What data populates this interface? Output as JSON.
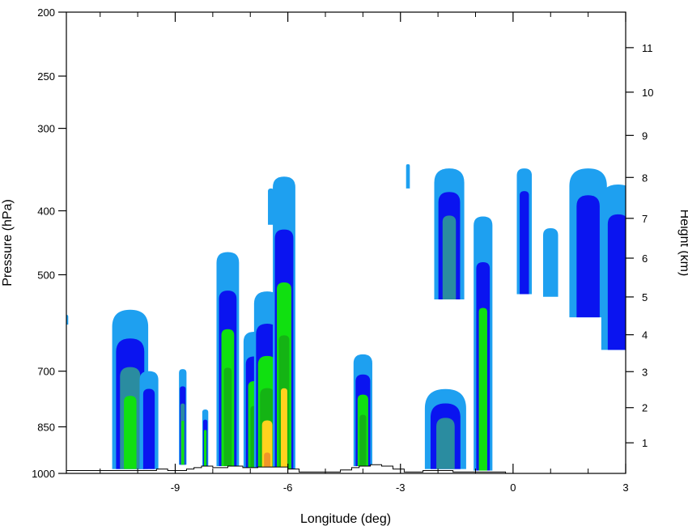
{
  "chart_data": {
    "type": "contour",
    "xlabel": "Longitude (deg)",
    "ylabel": "Pressure (hPa)",
    "y2label": "Height (km)",
    "xlim": [
      -11.9,
      3
    ],
    "ylim": [
      1000,
      200
    ],
    "yscale": "log",
    "x_ticks": [
      -9,
      -6,
      -3,
      0,
      3
    ],
    "x_tick_labels": [
      "-9",
      "-6",
      "-3",
      "0",
      "3"
    ],
    "y_ticks": [
      200,
      250,
      300,
      400,
      500,
      700,
      850,
      1000
    ],
    "y_tick_labels": [
      "200",
      "250",
      "300",
      "400",
      "500",
      "700",
      "850",
      "1000"
    ],
    "y2_ticks": [
      1,
      2,
      3,
      4,
      5,
      6,
      7,
      8,
      9,
      10,
      11
    ],
    "y2_tick_labels": [
      "1",
      "2",
      "3",
      "4",
      "5",
      "6",
      "7",
      "8",
      "9",
      "10",
      "11"
    ],
    "levels": [
      {
        "level": 1,
        "color": "#1ea0f0"
      },
      {
        "level": 2,
        "color": "#0a14f0"
      },
      {
        "level": 3,
        "color": "#2a8ca0"
      },
      {
        "level": 4,
        "color": "#10e010"
      },
      {
        "level": 5,
        "color": "#14b414"
      },
      {
        "level": 6,
        "color": "#ffd21e"
      },
      {
        "level": 7,
        "color": "#f09628"
      }
    ],
    "cells": [
      {
        "x": -10.2,
        "ptop": 565,
        "pbot": 985,
        "hw": 0.48,
        "levels": [
          1,
          2,
          3,
          4
        ]
      },
      {
        "x": -9.7,
        "ptop": 700,
        "pbot": 985,
        "hw": 0.25,
        "levels": [
          1,
          2
        ]
      },
      {
        "x": -8.8,
        "ptop": 695,
        "pbot": 970,
        "hw": 0.1,
        "levels": [
          1,
          2,
          3,
          4
        ]
      },
      {
        "x": -8.2,
        "ptop": 800,
        "pbot": 975,
        "hw": 0.08,
        "levels": [
          1,
          2,
          4
        ]
      },
      {
        "x": -7.6,
        "ptop": 462,
        "pbot": 975,
        "hw": 0.3,
        "levels": [
          1,
          2,
          4,
          5
        ]
      },
      {
        "x": -6.9,
        "ptop": 610,
        "pbot": 985,
        "hw": 0.28,
        "levels": [
          1,
          2,
          4,
          5
        ]
      },
      {
        "x": -6.55,
        "ptop": 530,
        "pbot": 990,
        "hw": 0.35,
        "levels": [
          1,
          2,
          4,
          5,
          6,
          7
        ]
      },
      {
        "x": -6.1,
        "ptop": 355,
        "pbot": 990,
        "hw": 0.3,
        "levels": [
          1,
          2,
          4,
          5,
          6
        ]
      },
      {
        "x": -6.45,
        "ptop": 370,
        "pbot": 420,
        "hw": 0.08,
        "levels": [
          1
        ]
      },
      {
        "x": -4.0,
        "ptop": 660,
        "pbot": 975,
        "hw": 0.25,
        "levels": [
          1,
          2,
          4,
          5
        ]
      },
      {
        "x": -2.8,
        "ptop": 340,
        "pbot": 370,
        "hw": 0.05,
        "levels": [
          1
        ]
      },
      {
        "x": -1.8,
        "ptop": 745,
        "pbot": 985,
        "hw": 0.55,
        "levels": [
          1,
          2,
          3
        ]
      },
      {
        "x": -1.7,
        "ptop": 345,
        "pbot": 545,
        "hw": 0.4,
        "levels": [
          1,
          2,
          3
        ]
      },
      {
        "x": -0.8,
        "ptop": 408,
        "pbot": 990,
        "hw": 0.25,
        "levels": [
          1,
          2,
          4
        ]
      },
      {
        "x": 0.3,
        "ptop": 345,
        "pbot": 535,
        "hw": 0.2,
        "levels": [
          1,
          2
        ]
      },
      {
        "x": 1.0,
        "ptop": 425,
        "pbot": 540,
        "hw": 0.2,
        "levels": [
          1
        ]
      },
      {
        "x": 2.0,
        "ptop": 345,
        "pbot": 580,
        "hw": 0.5,
        "levels": [
          1,
          2
        ]
      },
      {
        "x": 2.8,
        "ptop": 365,
        "pbot": 650,
        "hw": 0.45,
        "levels": [
          1,
          2
        ]
      },
      {
        "x": -11.9,
        "ptop": 575,
        "pbot": 595,
        "hw": 0.05,
        "levels": [
          1
        ]
      }
    ],
    "terrain": [
      [
        -11.9,
        990
      ],
      [
        -9.5,
        990
      ],
      [
        -9.5,
        985
      ],
      [
        -9.2,
        985
      ],
      [
        -9.2,
        990
      ],
      [
        -8.7,
        990
      ],
      [
        -8.7,
        985
      ],
      [
        -8.5,
        985
      ],
      [
        -8.5,
        980
      ],
      [
        -8.3,
        980
      ],
      [
        -8.3,
        975
      ],
      [
        -8.0,
        975
      ],
      [
        -8.0,
        980
      ],
      [
        -7.6,
        980
      ],
      [
        -7.6,
        975
      ],
      [
        -7.2,
        975
      ],
      [
        -7.2,
        980
      ],
      [
        -6.8,
        980
      ],
      [
        -6.8,
        978
      ],
      [
        -6.0,
        978
      ],
      [
        -6.0,
        985
      ],
      [
        -5.7,
        985
      ],
      [
        -5.7,
        995
      ],
      [
        -4.6,
        995
      ],
      [
        -4.6,
        988
      ],
      [
        -4.3,
        988
      ],
      [
        -4.3,
        980
      ],
      [
        -4.1,
        980
      ],
      [
        -4.1,
        975
      ],
      [
        -3.8,
        975
      ],
      [
        -3.8,
        970
      ],
      [
        -3.5,
        970
      ],
      [
        -3.5,
        975
      ],
      [
        -3.2,
        975
      ],
      [
        -3.2,
        985
      ],
      [
        -2.9,
        985
      ],
      [
        -2.9,
        995
      ],
      [
        -2.4,
        995
      ],
      [
        -2.4,
        990
      ],
      [
        -1.6,
        990
      ],
      [
        -1.6,
        995
      ],
      [
        -0.2,
        995
      ],
      [
        -0.2,
        998
      ]
    ]
  }
}
